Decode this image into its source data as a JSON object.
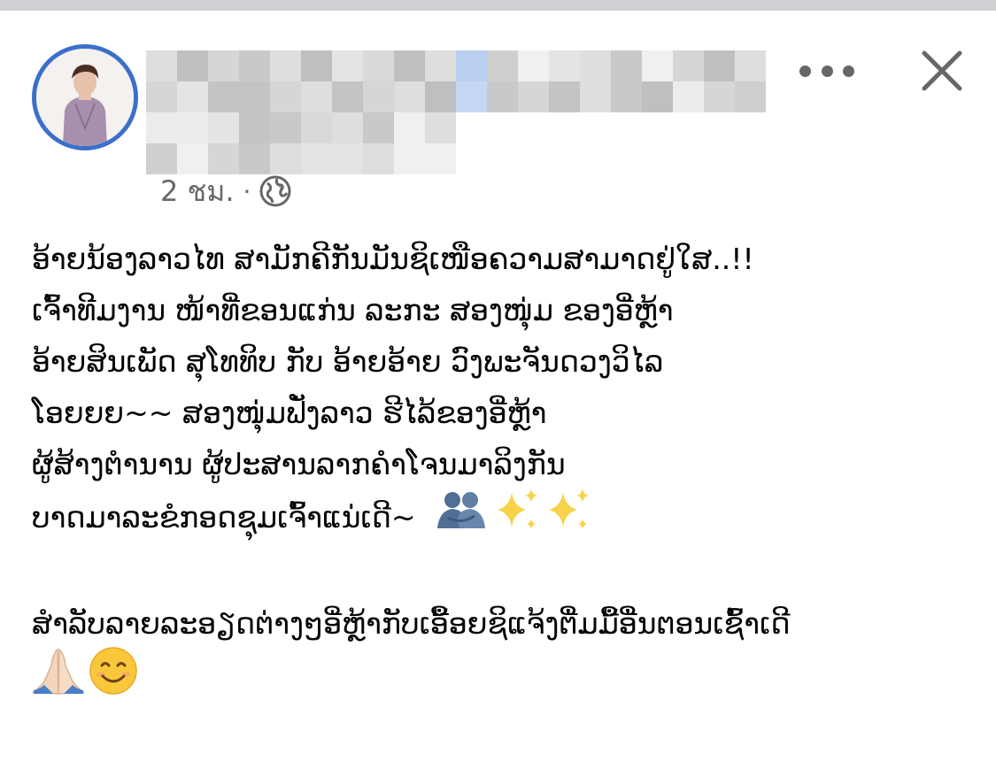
{
  "post": {
    "timestamp": "2 ชม.",
    "separator": "·",
    "privacy_icon": "globe-icon",
    "more_icon": "more-options-icon",
    "close_icon": "close-icon",
    "lines": [
      "ອ້າຍນ້ອງລາວໄທ ສາມັກຄີກັນມັນຊິເໜືອຄວາມສາມາດຢູ່ໃສ..!!",
      "ເຈົ້າທີມງານ ໜ້າທີ່ຂອນແກ່ນ ລະກະ ສອງໜຸ່ມ ຂອງອີ່ຫຼ້າ",
      "ອ້າຍສິນເພັດ ສຸໂທທິບ ກັບ ອ້າຍອ້າຍ ວົງພະຈັນດວງວິໄລ",
      "ໂອຍຍຍ~~ ສອງໜຸ່ມຟັ່ງລາວ ຮີໄລ້ຂອງອີ່ຫຼ້າ",
      "ຜູ້ສ້າງຕຳນານ ຜູ້ປະສານລາກຄຳໂຈນມາລິງກັນ",
      "ບາດມາລະຂໍກອດຊຸມເຈົ້າແນ່ເດີ~"
    ],
    "line6_emojis": [
      "people-hugging",
      "sparkles",
      "sparkles"
    ],
    "second_paragraph": "ສຳລັບລາຍລະອຽດຕ່າງໆອີ່ຫຼ້າກັບເອື້ອຍຊິແຈ້ງຕື່ມມື້ອື່ນຕອນເຊົ້າເດີ",
    "final_emojis": [
      "folded-hands",
      "smiling-face"
    ]
  },
  "colors": {
    "avatar_ring": "#3b6fc9",
    "meta_text": "#65676b",
    "body_text": "#050505",
    "top_strip": "#ced0d4"
  }
}
